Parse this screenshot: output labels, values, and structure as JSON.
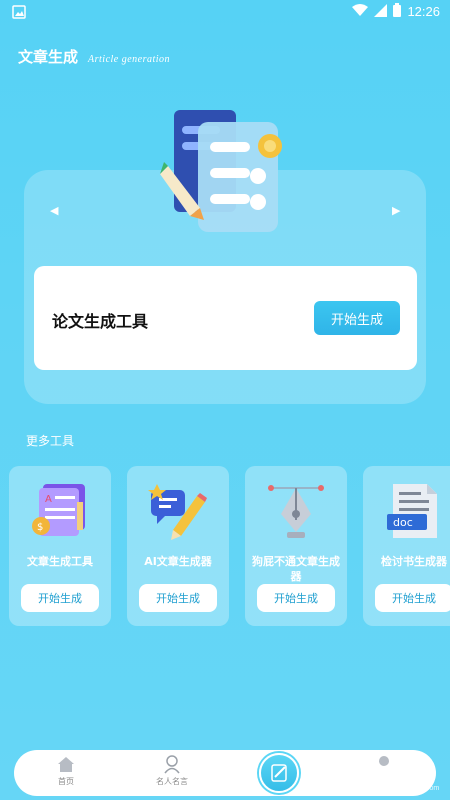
{
  "status_bar": {
    "time": "12:26"
  },
  "header": {
    "title": "文章生成",
    "subtitle": "Article generation"
  },
  "hero": {
    "prev_arrow": "◀",
    "next_arrow": "▶",
    "item_label": "论文生成工具",
    "button_label": "开始生成"
  },
  "more_tools": {
    "section_title": "更多工具",
    "items": [
      {
        "name": "文章生成工具",
        "button": "开始生成",
        "icon": "document-coin-icon"
      },
      {
        "name": "AI文章生成器",
        "button": "开始生成",
        "icon": "chat-pencil-icon"
      },
      {
        "name": "狗屁不通文章生成器",
        "button": "开始生成",
        "icon": "pen-nib-icon"
      },
      {
        "name": "检讨书生成器",
        "button": "开始生成",
        "icon": "doc-file-icon"
      }
    ]
  },
  "bottom_nav": {
    "items": [
      {
        "label": "首页",
        "icon": "home-icon"
      },
      {
        "label": "名人名言",
        "icon": "person-icon"
      },
      {
        "label": "",
        "icon": "write-icon"
      },
      {
        "label": "",
        "icon": "profile-icon"
      }
    ]
  },
  "watermark": {
    "text": "pc6.com"
  },
  "colors": {
    "background": "#56d2f5",
    "accent": "#2fb4e8",
    "card": "#ffffff"
  }
}
